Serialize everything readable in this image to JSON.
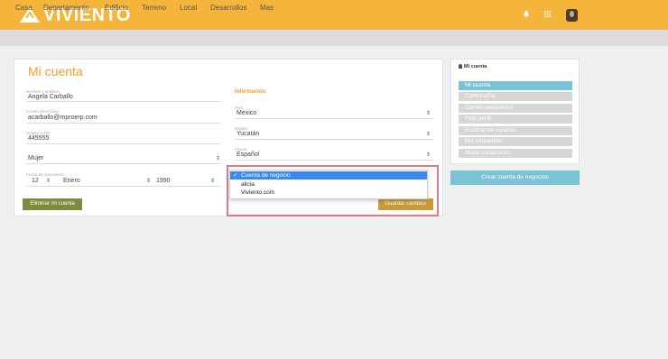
{
  "header": {
    "brand": "VIVIENTO",
    "icons": [
      "bell-icon",
      "grid-icon",
      "avatar"
    ],
    "colors": {
      "topbar": "#f5b53b",
      "nav": "#dcdcdc",
      "accent": "#ef9d2d"
    }
  },
  "nav": {
    "items": [
      "Casa",
      "Departamento",
      "Edificio",
      "Terreno",
      "Local",
      "Desarrollos",
      "Mas"
    ]
  },
  "account": {
    "title": "Mi cuenta",
    "name": {
      "label": "Nombre y apellido",
      "value": "Angela Carballo"
    },
    "email": {
      "label": "Correo electrónico",
      "value": "acarballo@mproerp.com"
    },
    "phone": {
      "label": "Celular móvil",
      "value": "445555"
    },
    "gender": {
      "value": "Mujer"
    },
    "birthdate": {
      "label": "Fecha de nacimiento",
      "day": "12",
      "month": "Enero",
      "year": "1990"
    },
    "delete_button": "Eliminar mi cuenta"
  },
  "info": {
    "section_label": "Información",
    "country": {
      "label": "País",
      "value": "México"
    },
    "state": {
      "label": "Estado",
      "value": "Yucatán"
    },
    "language": {
      "label": "Idioma",
      "value": "Español"
    },
    "account_dropdown": {
      "options": [
        "Cuenta de negocio",
        "alicia",
        "Viviento.com"
      ],
      "selected": "Cuenta de negocio",
      "check": "✓"
    },
    "save_button": "Guardar cambios"
  },
  "sidebar": {
    "title": "Mi cuenta",
    "items": [
      "Mi cuenta",
      "Contraseña",
      "Correo electrónico",
      "Foto perfil",
      "Publicar en viviento",
      "Mis inmuebles",
      "Modo vacaciones"
    ],
    "active": "Mi cuenta",
    "business_button": "Crear cuenta de negocios"
  }
}
